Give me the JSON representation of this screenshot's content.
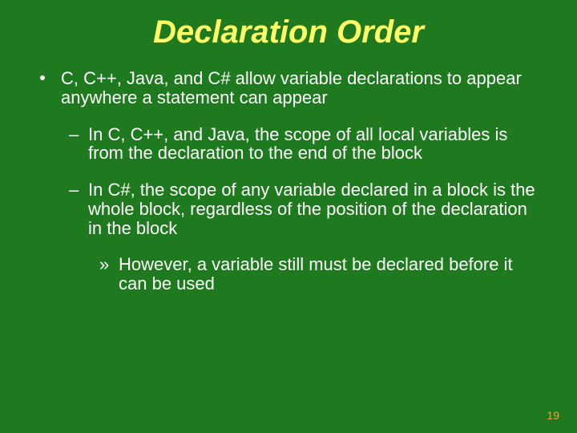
{
  "title": "Declaration Order",
  "bullets": {
    "l1": "C, C++, Java, and C# allow variable declarations to appear anywhere a statement can appear",
    "l2a": "In C, C++, and Java, the scope of all local variables is from the declaration to the end of the block",
    "l2b": "In C#, the scope of any variable declared in a block is the whole block, regardless of the position of the declaration in the block",
    "l3": "However, a variable still must be declared before it can be used"
  },
  "page_number": "19"
}
